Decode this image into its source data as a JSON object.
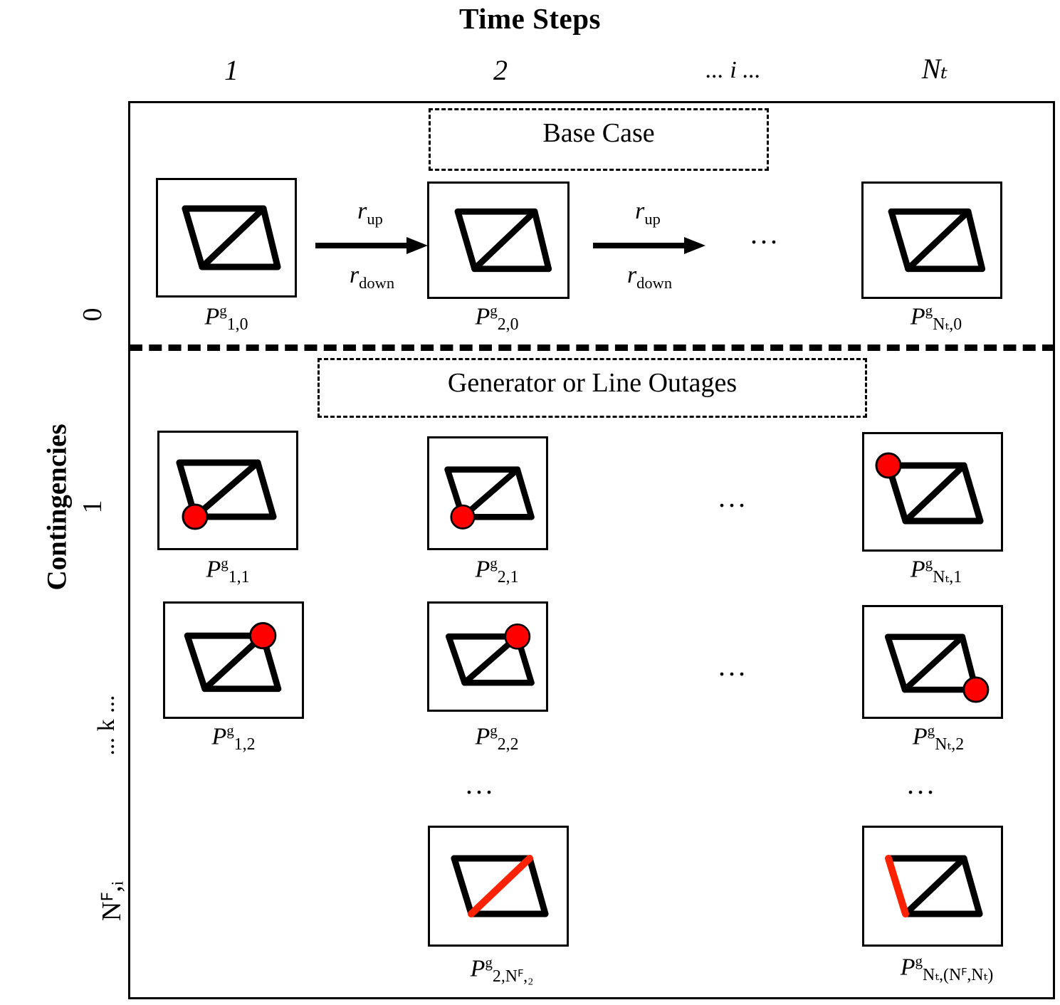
{
  "titles": {
    "top": "Time Steps",
    "left": "Contingencies"
  },
  "column_headers": [
    {
      "id": "col-1",
      "label": "1"
    },
    {
      "id": "col-2",
      "label": "2"
    },
    {
      "id": "col-i",
      "label": "... i ..."
    },
    {
      "id": "col-Nt",
      "label": "Nₜ"
    }
  ],
  "row_headers": [
    {
      "id": "row-0",
      "label": "0"
    },
    {
      "id": "row-1",
      "label": "1"
    },
    {
      "id": "row-k",
      "label": "... k ..."
    },
    {
      "id": "row-Nci",
      "label": "Nꟳ,ᵢ"
    }
  ],
  "captions": {
    "base_case": "Base Case",
    "outages": "Generator or Line Outages"
  },
  "arrows": [
    {
      "id": "arrow-1",
      "up_label": "r",
      "up_sub": "up",
      "down_label": "r",
      "down_sub": "down"
    },
    {
      "id": "arrow-2",
      "up_label": "r",
      "up_sub": "up",
      "down_label": "r",
      "down_sub": "down"
    }
  ],
  "cells": [
    {
      "id": "cell-1-0",
      "row": 0,
      "col": 1,
      "label_base": "P",
      "label_sup": "g",
      "label_sub": "1,0",
      "fault": "none"
    },
    {
      "id": "cell-2-0",
      "row": 0,
      "col": 2,
      "label_base": "P",
      "label_sup": "g",
      "label_sub": "2,0",
      "fault": "none"
    },
    {
      "id": "cell-Nt-0",
      "row": 0,
      "col": "Nt",
      "label_base": "P",
      "label_sup": "g",
      "label_sub": "Nₜ,0",
      "fault": "none"
    },
    {
      "id": "cell-1-1",
      "row": 1,
      "col": 1,
      "label_base": "P",
      "label_sup": "g",
      "label_sub": "1,1",
      "fault": "node-bottom-left"
    },
    {
      "id": "cell-2-1",
      "row": 1,
      "col": 2,
      "label_base": "P",
      "label_sup": "g",
      "label_sub": "2,1",
      "fault": "node-bottom-left"
    },
    {
      "id": "cell-Nt-1",
      "row": 1,
      "col": "Nt",
      "label_base": "P",
      "label_sup": "g",
      "label_sub": "Nₜ,1",
      "fault": "node-top-left"
    },
    {
      "id": "cell-1-2",
      "row": 2,
      "col": 1,
      "label_base": "P",
      "label_sup": "g",
      "label_sub": "1,2",
      "fault": "node-top-right"
    },
    {
      "id": "cell-2-2",
      "row": 2,
      "col": 2,
      "label_base": "P",
      "label_sup": "g",
      "label_sub": "2,2",
      "fault": "node-top-right"
    },
    {
      "id": "cell-Nt-2",
      "row": 2,
      "col": "Nt",
      "label_base": "P",
      "label_sup": "g",
      "label_sub": "Nₜ,2",
      "fault": "node-bottom-right"
    },
    {
      "id": "cell-2-Nc2",
      "row": "Nc",
      "col": 2,
      "label_base": "P",
      "label_sup": "g",
      "label_sub": "2,Nꟳ,₂",
      "fault": "line-diagonal"
    },
    {
      "id": "cell-Nt-NcNt",
      "row": "Nc",
      "col": "Nt",
      "label_base": "P",
      "label_sup": "g",
      "label_sub": "Nₜ,(Nꟳ,Nₜ)",
      "fault": "line-left"
    }
  ],
  "ellipses": [
    {
      "id": "ellipsis-row0-right",
      "text": "..."
    },
    {
      "id": "ellipsis-row1-mid",
      "text": "..."
    },
    {
      "id": "ellipsis-row2-mid",
      "text": "..."
    },
    {
      "id": "ellipsis-col2-below",
      "text": "..."
    },
    {
      "id": "ellipsis-colNt-below",
      "text": "..."
    }
  ],
  "colors": {
    "fault_node": "#FF0000",
    "fault_line": "#FF2200",
    "network_line": "#000000",
    "frame": "#000000",
    "background": "#FFFFFF"
  }
}
